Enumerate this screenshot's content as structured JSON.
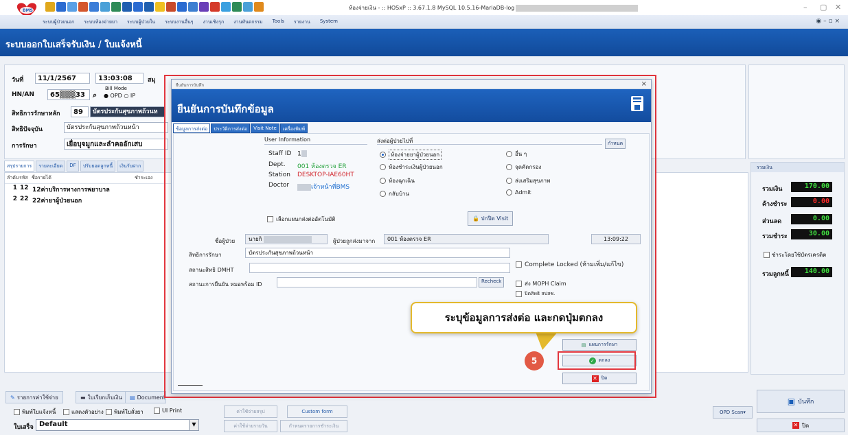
{
  "window": {
    "title": "ห้องจ่ายเงิน - :: HOSxP :: 3.67.1.8 MySQL 10.5.16-MariaDB-log",
    "controls": [
      "–",
      "▢",
      "✕"
    ]
  },
  "menu": {
    "items": [
      "ระบบผู้ป่วยนอก",
      "ระบบห้องจ่ายยา",
      "ระบบผู้ป่วยใน",
      "ระบบงานอื่นๆ",
      "งานเชิงรุก",
      "งานทันตกรรม",
      "Tools",
      "รายงาน",
      "System"
    ],
    "right": "◉ – ▫ ×"
  },
  "header": {
    "title": "ระบบออกใบเสร็จรับเงิน / ใบแจ้งหนี้"
  },
  "form": {
    "date_label": "วันที่",
    "date_value": "11/1/2567",
    "time_value": "13:03:08",
    "summary_label": "สมุ",
    "hn_label": "HN/AN",
    "hn_value": "65▒▒▒33",
    "bill_mode_label": "Bill Mode",
    "bill_mode_opd": "OPD",
    "bill_mode_ipd": "IP",
    "main_right_label": "สิทธิการรักษาหลัก",
    "main_right_code": "89",
    "main_right_name": "บัตรประกันสุขภาพถ้วนห",
    "current_right_label": "สิทธิปัจจุบัน",
    "current_right_value": "บัตรประกันสุขภาพถ้วนหน้า",
    "treatment_label": "การรักษา",
    "treatment_value": "เยื่อบุจมูกและลำคออักเสบ"
  },
  "bg_tabs": [
    "สรุปรายการ",
    "รายละเอียด",
    "DF",
    "ปรับยอดลูกหนี้",
    "เงินรับฝาก"
  ],
  "list": {
    "headers": [
      "ลำดับ",
      "รหัส",
      "ชื่อรายได้",
      "ชำระเอง"
    ],
    "rows": [
      {
        "no": "1",
        "code": "12",
        "name": "12ค่าบริการทางการพยาบาล"
      },
      {
        "no": "2",
        "code": "22",
        "name": "22ค่ายาผู้ป่วยนอก"
      }
    ]
  },
  "summary": {
    "heading": "รวมเงิน",
    "total_label": "รวมเงิน",
    "total": "170.00",
    "debt_label": "ค้างชำระ",
    "debt": "0.00",
    "discount_label": "ส่วนลด",
    "discount": "0.00",
    "paid_label": "รวมชำระ",
    "paid": "30.00",
    "card_pay_label": "ชำระโดยใช้บัตรเครดิต",
    "receivable_label": "รวมลูกหนี้",
    "receivable": "140.00"
  },
  "bottom": {
    "tab_expenses": "รายการค่าใช้จ่าย",
    "tab_receipt": "ใบเรียกเก็บเงิน",
    "tab_document": "Document",
    "check_invoice": "พิมพ์ใบแจ้งหนี้",
    "check_preview": "แสดงตัวอย่าง",
    "check_drug": "พิมพ์ใบสั่งยา",
    "check_ui": "UI Print",
    "btn_summary": "ค่าใช้จ่ายสรุป",
    "btn_custom": "Custom form",
    "btn_daily": "ค่าใช้จ่ายรายวัน",
    "btn_payment": "กำหนดรายการชำระเงิน",
    "receipt_label": "ใบเสร็จ",
    "receipt_select": "Default",
    "opd_scan": "OPD Scan▾",
    "save": "บันทึก",
    "close": "ปิด"
  },
  "dialog": {
    "caption": "ยืนยันการบันทึก",
    "close_x": "×",
    "banner_title": "ยืนยันการบันทึกข้อมูล",
    "tabs": [
      "ข้อมูลการส่งต่อ",
      "ประวัติการส่งต่อ",
      "Visit Note",
      "เครื่องพิมพ์"
    ],
    "user_info": {
      "title": "User Information",
      "staff_label": "Staff ID",
      "staff_value": "1",
      "dept_label": "Dept.",
      "dept_value": "001 ห้องตรวจ ER",
      "station_label": "Station",
      "station_value": "DESKTOP-IAE60HT",
      "doctor_label": "Doctor",
      "doctor_value": "เจ้าหน้าที่BMS"
    },
    "send_to": {
      "title": "ส่งต่อผู้ป่วยไปที่",
      "set_button": "กำหนด",
      "options_left": [
        "ห้องจ่ายยาผู้ป่วยนอก",
        "ห้องชำระเงินผู้ป่วยนอก",
        "ห้องฉุกเฉิน",
        "กลับบ้าน"
      ],
      "options_right": [
        "อื่น ๆ",
        "จุดคัดกรอง",
        "ส่งเสริมสุขภาพ",
        "Admit"
      ],
      "selected": "ห้องจ่ายยาผู้ป่วยนอก"
    },
    "auto_plan": "เลือกแผนกส่งต่ออัตโนมัติ",
    "close_visit": "ปกปิด Visit",
    "patient_label": "ชื่อผู้ป่วย",
    "patient_value": "นายกิ",
    "sent_from_label": "ผู้ป่วยถูกส่งมาจาก",
    "sent_from_value": "001 ห้องตรวจ ER",
    "sent_time": "13:09:22",
    "right_label": "สิทธิการรักษา",
    "right_value": "บัตรประกันสุขภาพถ้วนหน้า",
    "dmht_label": "สถานะสิทธิ DMHT",
    "confirm_label": "สถานะการยืนยัน หมอพร้อม ID",
    "recheck": "Recheck",
    "complete_locked": "Complete Locked (ห้ามเพิ่ม/แก้ไข)",
    "moph_claim": "ส่ง MOPH Claim",
    "close_right": "ปิดสิทธิ สปสช.",
    "plan_button": "แผนการรักษา",
    "ok_button": "ตกลง",
    "close_button": "ปิด"
  },
  "annotation": {
    "callout": "ระบุข้อมูลการส่งต่อ และกดปุ่มตกลง",
    "step": "5"
  },
  "colors": {
    "header_blue": "#1b5fb8",
    "highlight_red": "#e2353d",
    "callout_border": "#e4b92c",
    "total_green": "#40e040",
    "debt_red": "#ff2a2a"
  }
}
